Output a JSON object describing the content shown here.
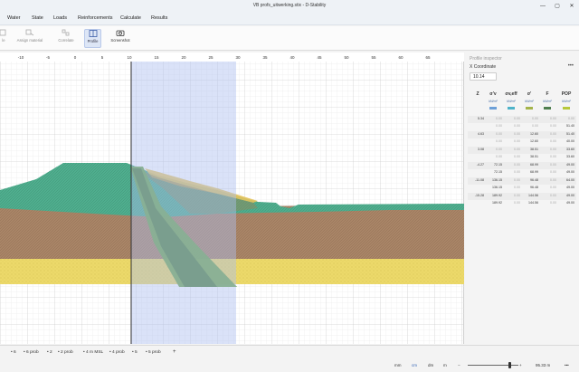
{
  "window": {
    "title": "VB profs_uitwerking.stix - D-Stability",
    "minimize": "—",
    "maximize": "▢",
    "close": "✕"
  },
  "menu": [
    "Water",
    "State",
    "Loads",
    "Reinforcements",
    "Calculate",
    "Results"
  ],
  "ribbon": {
    "buttons": [
      {
        "label": "Profile",
        "icon": "profile-icon",
        "active": true
      },
      {
        "label": "Screenshot",
        "icon": "camera-icon",
        "active": false
      }
    ],
    "disabled_buttons": [
      {
        "label": "Assign material",
        "icon": "assign-material-icon"
      },
      {
        "label": "Correlate",
        "icon": "correlate-icon"
      }
    ],
    "partial_button": {
      "label": "le",
      "icon": "partial-icon"
    }
  },
  "canvas": {
    "ruler_ticks": [
      "-10",
      "-5",
      "0",
      "5",
      "10",
      "15",
      "20",
      "25",
      "30",
      "35",
      "40",
      "45",
      "50",
      "55",
      "60",
      "65"
    ],
    "layer_colors": {
      "embankment": "#4fae8e",
      "clay": "#a98567",
      "sand": "#e9d463",
      "reinforcement": "#6aa34a",
      "selection": "#aebfef"
    }
  },
  "inspector": {
    "title": "Profile inspector",
    "x_label": "X Coordinate",
    "x_value": "10.14",
    "menu_dots": "•••",
    "columns": [
      {
        "symbol": "Z",
        "unit": ""
      },
      {
        "symbol": "σ'v",
        "unit": "kN/m²"
      },
      {
        "symbol": "σv,eff",
        "unit": "kN/m²"
      },
      {
        "symbol": "σ'",
        "unit": "kN/m²"
      },
      {
        "symbol": "F",
        "unit": "kN/m²"
      },
      {
        "symbol": "POP",
        "unit": "kN/m²"
      }
    ],
    "swatch_colors": [
      "#6da0d8",
      "#4db3c9",
      "#a4b44a",
      "#4f7f4f",
      "#b7c83a"
    ],
    "rows": [
      {
        "z": "5.34",
        "v1": "0.00",
        "v2": "0.00",
        "v3": "0.00",
        "v4": "0.00",
        "v5": "0.00"
      },
      {
        "z": "",
        "v1": "0.00",
        "v2": "0.00",
        "v3": "0.00",
        "v4": "0.00",
        "v5": "51.40"
      },
      {
        "z": "4.63",
        "v1": "0.00",
        "v2": "0.00",
        "v3": "12.60",
        "v4": "0.00",
        "v5": "51.40"
      },
      {
        "z": "",
        "v1": "0.00",
        "v2": "0.00",
        "v3": "12.60",
        "v4": "0.00",
        "v5": "40.00"
      },
      {
        "z": "3.08",
        "v1": "0.00",
        "v2": "0.00",
        "v3": "38.51",
        "v4": "0.00",
        "v5": "33.60"
      },
      {
        "z": "",
        "v1": "0.00",
        "v2": "0.00",
        "v3": "38.51",
        "v4": "0.00",
        "v5": "33.60"
      },
      {
        "z": "-4.27",
        "v1": "72.15",
        "v2": "0.00",
        "v3": "68.99",
        "v4": "0.00",
        "v5": "49.00"
      },
      {
        "z": "",
        "v1": "72.15",
        "v2": "0.00",
        "v3": "68.99",
        "v4": "0.00",
        "v5": "49.00"
      },
      {
        "z": "-11.08",
        "v1": "136.15",
        "v2": "0.00",
        "v3": "96.48",
        "v4": "0.00",
        "v5": "64.00"
      },
      {
        "z": "",
        "v1": "136.15",
        "v2": "0.00",
        "v3": "96.48",
        "v4": "0.00",
        "v5": "49.00"
      },
      {
        "z": "-15.28",
        "v1": "189.92",
        "v2": "0.00",
        "v3": "144.56",
        "v4": "0.00",
        "v5": "49.00"
      },
      {
        "z": "",
        "v1": "189.92",
        "v2": "0.00",
        "v3": "144.56",
        "v4": "0.00",
        "v5": "49.00"
      }
    ]
  },
  "tabs": [
    "6",
    "6 prob",
    "2",
    "2 prob",
    "4 m MSL",
    "4 prob",
    "5",
    "5 prob"
  ],
  "add_tab": "+",
  "bottom": {
    "units": [
      "mm",
      "cm",
      "dm",
      "m"
    ],
    "zoom": "95.33 m",
    "dots": "•••"
  }
}
